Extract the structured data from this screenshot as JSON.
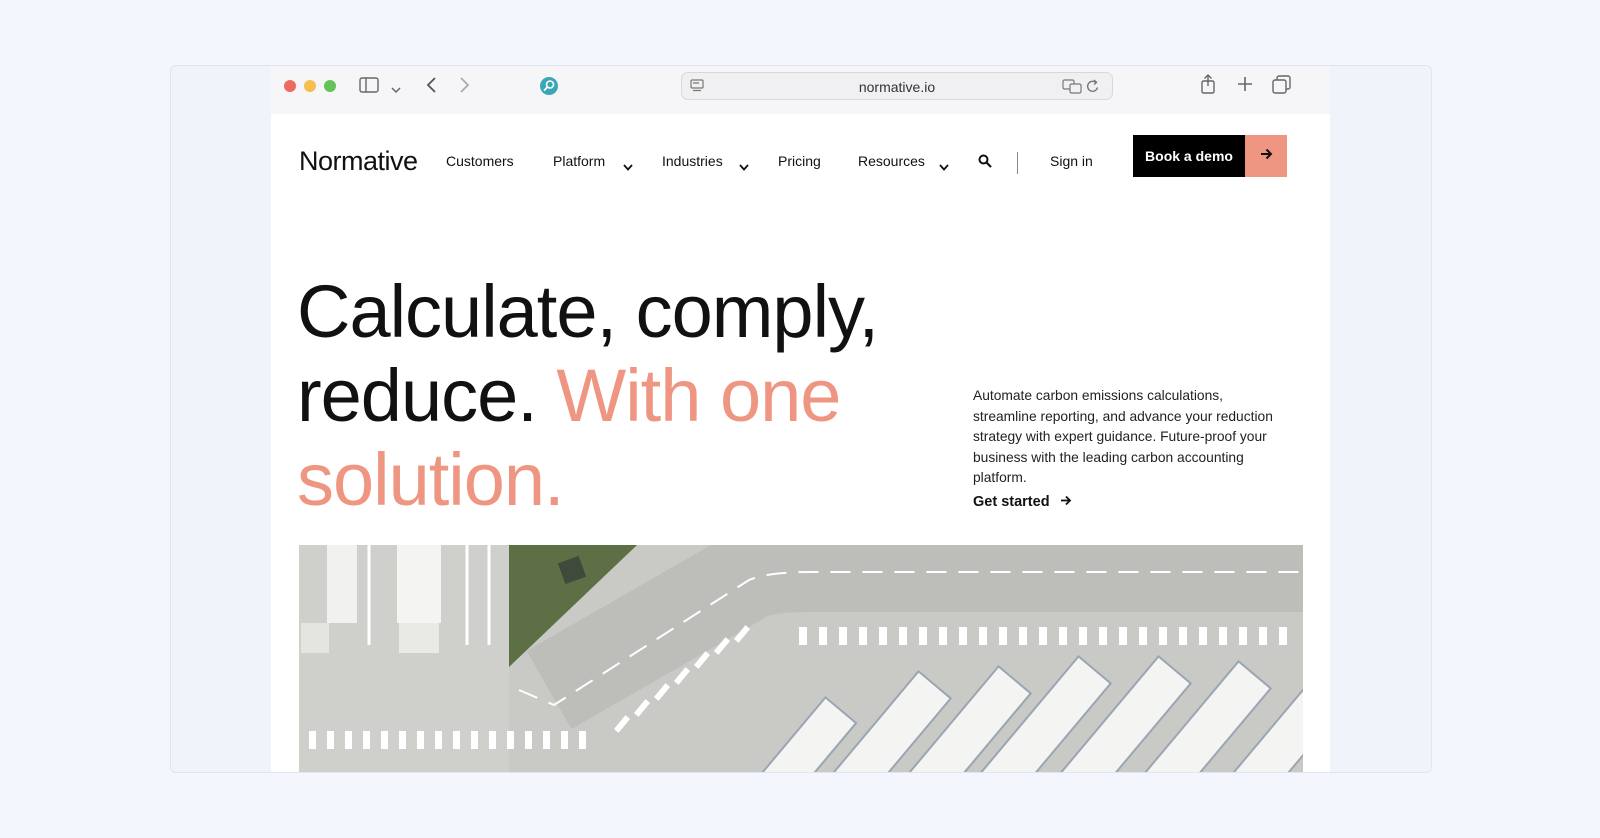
{
  "browser": {
    "address": "normative.io"
  },
  "nav": {
    "logo": "Normative",
    "items": [
      "Customers",
      "Platform",
      "Industries",
      "Pricing",
      "Resources"
    ],
    "sign_in": "Sign in",
    "book_demo": "Book a demo"
  },
  "hero": {
    "headline_black": "Calculate, comply, reduce.",
    "headline_accent": "With one solution.",
    "description": "Automate carbon emissions calculations, streamline reporting, and advance your reduction strategy with expert guidance. Future-proof your business with the leading carbon accounting platform.",
    "cta": "Get started"
  },
  "colors": {
    "accent": "#ef9683",
    "button_dark": "#000000",
    "background": "#f3f6fc"
  },
  "icons": [
    "sidebar-icon",
    "chevron-down-icon",
    "back-icon",
    "forward-icon",
    "privacy-icon",
    "reader-icon",
    "translate-icon",
    "reload-icon",
    "share-icon",
    "new-tab-icon",
    "tabs-icon",
    "search-icon",
    "arrow-right-icon"
  ]
}
